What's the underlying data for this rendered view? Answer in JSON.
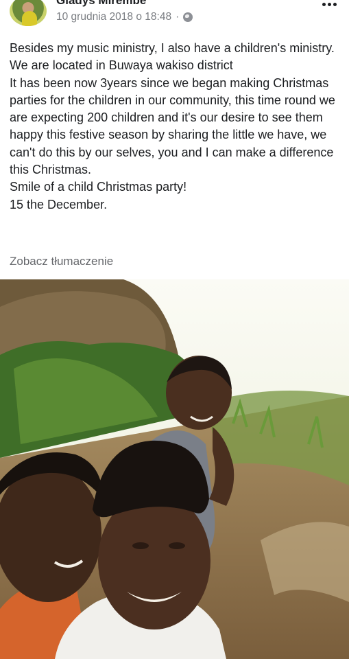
{
  "post": {
    "author": "Gladys Mirembe",
    "timestamp": "10 grudnia 2018 o 18:48",
    "separator": "·",
    "privacy_icon": "globe-icon",
    "more_icon": "more-options-icon",
    "lines": [
      "Besides my music ministry, I also have a children's ministry.",
      "We are located in Buwaya wakiso district",
      "It has been now 3years since we began making Christmas parties for the children in our community, this time round we are expecting 200 children and it's our desire to see them happy this festive season by sharing the little we have, we can't do this by our selves, you and I can make a difference this Christmas.",
      "Smile of a child Christmas party!",
      "15 the December."
    ],
    "translate_label": "Zobacz tłumaczenie"
  }
}
